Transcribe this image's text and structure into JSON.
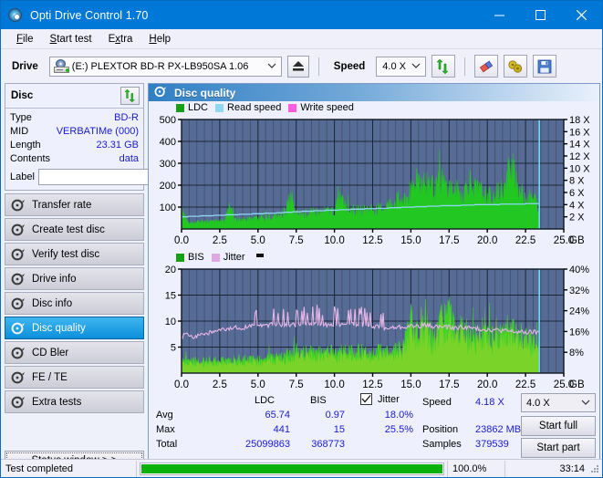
{
  "window": {
    "title": "Opti Drive Control 1.70",
    "icon": "disc-icon",
    "minimize_label": "–",
    "maximize_label": "□",
    "close_label": "✕",
    "accent": "#0078d7"
  },
  "menu": {
    "items": [
      {
        "label": "File",
        "accel": "F"
      },
      {
        "label": "Start test",
        "accel": "S"
      },
      {
        "label": "Extra",
        "accel": "x"
      },
      {
        "label": "Help",
        "accel": "H"
      }
    ]
  },
  "toolbar": {
    "drive_label": "Drive",
    "drive_value": "(E:)  PLEXTOR BD-R  PX-LB950SA 1.06",
    "eject_icon": "eject-icon",
    "speed_label": "Speed",
    "speed_value": "4.0 X",
    "refresh_icon": "refresh-icon",
    "eraser_icon": "eraser-icon",
    "bitsetting_icon": "bitsetting-icon",
    "save_icon": "save-icon"
  },
  "disc_panel": {
    "title": "Disc",
    "refresh_icon": "refresh-icon",
    "rows": [
      {
        "key": "Type",
        "value": "BD-R"
      },
      {
        "key": "MID",
        "value": "VERBATIMe (000)"
      },
      {
        "key": "Length",
        "value": "23.31 GB"
      },
      {
        "key": "Contents",
        "value": "data"
      }
    ],
    "label_key": "Label",
    "label_value": "",
    "label_placeholder": "",
    "label_button_icon": "disc-icon"
  },
  "sidebar": {
    "items": [
      {
        "label": "Transfer rate",
        "icon": "disc-test-icon",
        "active": false
      },
      {
        "label": "Create test disc",
        "icon": "disc-test-icon",
        "active": false
      },
      {
        "label": "Verify test disc",
        "icon": "disc-test-icon",
        "active": false
      },
      {
        "label": "Drive info",
        "icon": "disc-test-icon",
        "active": false
      },
      {
        "label": "Disc info",
        "icon": "disc-test-icon",
        "active": false
      },
      {
        "label": "Disc quality",
        "icon": "disc-test-icon",
        "active": true
      },
      {
        "label": "CD Bler",
        "icon": "disc-test-icon",
        "active": false
      },
      {
        "label": "FE / TE",
        "icon": "disc-test-icon",
        "active": false
      },
      {
        "label": "Extra tests",
        "icon": "disc-test-icon",
        "active": false
      }
    ],
    "status_window_label": "Status window > >"
  },
  "main": {
    "header_title": "Disc quality",
    "header_icon": "disc-quality-icon"
  },
  "chart_data": [
    {
      "type": "area",
      "id": "ldc-chart",
      "title": "",
      "legend": [
        {
          "label": "LDC",
          "color": "#16a016"
        },
        {
          "label": "Read speed",
          "color": "#8fd8f4"
        },
        {
          "label": "Write speed",
          "color": "#ff5ce0"
        }
      ],
      "legend_position": "top-left",
      "xlabel": "GB",
      "ylabel": "",
      "xlim": [
        0.0,
        25.0
      ],
      "xticks": [
        "0.0",
        "2.5",
        "5.0",
        "7.5",
        "10.0",
        "12.5",
        "15.0",
        "17.5",
        "20.0",
        "22.5",
        "25.0"
      ],
      "ylim": [
        0,
        500
      ],
      "yticks": [
        "100",
        "200",
        "300",
        "400",
        "500"
      ],
      "y2lim": [
        0,
        18
      ],
      "y2ticks": [
        "2 X",
        "4 X",
        "6 X",
        "8 X",
        "10 X",
        "12 X",
        "14 X",
        "16 X",
        "18 X"
      ],
      "grid": true,
      "plot_bg": "#566c96",
      "data_end_gb": 23.4,
      "marker_gb": 23.4,
      "series": [
        {
          "name": "LDC",
          "color": "#22c722",
          "x": [
            0.0,
            0.4,
            0.8,
            1.2,
            1.6,
            2.0,
            2.4,
            2.8,
            3.2,
            3.4,
            3.6,
            4.0,
            4.4,
            4.8,
            5.2,
            5.6,
            6.0,
            6.4,
            6.8,
            7.2,
            7.4,
            7.6,
            8.0,
            8.4,
            8.8,
            9.2,
            9.6,
            10.0,
            10.4,
            10.8,
            11.2,
            11.6,
            12.0,
            12.4,
            12.8,
            13.2,
            13.6,
            14.0,
            14.4,
            14.8,
            15.2,
            15.4,
            15.8,
            16.2,
            16.6,
            17.0,
            17.2,
            17.6,
            18.0,
            18.4,
            18.8,
            19.2,
            19.6,
            20.0,
            20.4,
            20.8,
            21.2,
            21.6,
            22.0,
            22.2,
            22.4,
            22.8,
            23.2,
            23.4
          ],
          "values": [
            120,
            42,
            40,
            45,
            48,
            44,
            50,
            48,
            170,
            60,
            55,
            58,
            60,
            62,
            68,
            70,
            75,
            80,
            110,
            200,
            95,
            90,
            95,
            100,
            105,
            100,
            110,
            115,
            200,
            120,
            118,
            115,
            120,
            125,
            118,
            135,
            150,
            175,
            180,
            200,
            270,
            340,
            280,
            300,
            230,
            310,
            260,
            250,
            230,
            200,
            310,
            240,
            225,
            200,
            215,
            230,
            255,
            440,
            290,
            220,
            200,
            190,
            175,
            60
          ]
        },
        {
          "name": "Read speed",
          "color": "#8fd8f4",
          "x": [
            0.0,
            1.0,
            2.0,
            3.0,
            4.0,
            5.0,
            6.0,
            7.0,
            8.0,
            9.0,
            10.0,
            11.0,
            12.0,
            13.0,
            14.0,
            15.0,
            16.0,
            17.0,
            18.0,
            19.0,
            20.0,
            21.0,
            22.0,
            23.0,
            23.4
          ],
          "values": [
            2.0,
            2.1,
            2.2,
            2.3,
            2.4,
            2.5,
            2.6,
            2.75,
            2.9,
            3.0,
            3.1,
            3.2,
            3.3,
            3.4,
            3.5,
            3.6,
            3.7,
            3.8,
            3.85,
            3.95,
            4.0,
            4.05,
            4.1,
            4.15,
            4.18
          ]
        }
      ]
    },
    {
      "type": "area",
      "id": "bis-jitter-chart",
      "title": "",
      "legend": [
        {
          "label": "BIS",
          "color": "#16a016"
        },
        {
          "label": "Jitter",
          "color": "#e0a8e0"
        }
      ],
      "legend_position": "top-left",
      "xlabel": "GB",
      "ylabel": "",
      "xlim": [
        0.0,
        25.0
      ],
      "xticks": [
        "0.0",
        "2.5",
        "5.0",
        "7.5",
        "10.0",
        "12.5",
        "15.0",
        "17.5",
        "20.0",
        "22.5",
        "25.0"
      ],
      "ylim": [
        0,
        20
      ],
      "yticks": [
        "5",
        "10",
        "15",
        "20"
      ],
      "y2lim": [
        0,
        40
      ],
      "y2ticks": [
        "8%",
        "16%",
        "24%",
        "32%",
        "40%"
      ],
      "grid": true,
      "plot_bg": "#566c96",
      "data_end_gb": 23.4,
      "marker_gb": 23.4,
      "series": [
        {
          "name": "BIS",
          "color": "#33d433",
          "x": [
            0.0,
            0.5,
            1.0,
            1.5,
            2.0,
            2.5,
            3.0,
            3.5,
            4.0,
            4.5,
            5.0,
            5.5,
            6.0,
            6.5,
            7.0,
            7.5,
            8.0,
            8.5,
            9.0,
            9.5,
            10.0,
            10.5,
            11.0,
            11.5,
            12.0,
            12.5,
            13.0,
            13.5,
            14.0,
            14.5,
            15.0,
            15.2,
            15.6,
            16.0,
            16.5,
            17.0,
            17.5,
            17.9,
            18.3,
            18.8,
            19.3,
            19.8,
            20.3,
            20.8,
            21.3,
            21.8,
            22.2,
            22.6,
            23.0,
            23.4
          ],
          "values": [
            3.0,
            3.2,
            3.1,
            3.0,
            3.3,
            3.2,
            3.1,
            3.3,
            3.2,
            3.4,
            3.6,
            3.5,
            3.8,
            4.2,
            4.6,
            5.0,
            5.2,
            5.4,
            5.3,
            5.5,
            5.6,
            5.4,
            5.5,
            5.7,
            5.6,
            5.8,
            5.5,
            5.7,
            6.0,
            6.4,
            13.0,
            9.0,
            10.5,
            12.0,
            8.5,
            13.0,
            15.0,
            9.5,
            13.0,
            8.6,
            9.0,
            11.0,
            8.8,
            9.2,
            12.2,
            10.0,
            8.6,
            9.0,
            7.5,
            6.0
          ]
        },
        {
          "name": "Jitter",
          "color": "#e7b6e7",
          "x": [
            0.0,
            0.3,
            0.6,
            0.9,
            1.2,
            1.5,
            1.8,
            2.1,
            2.4,
            2.7,
            3.0,
            3.3,
            3.6,
            3.9,
            4.2,
            4.5,
            4.8,
            5.1,
            5.4,
            5.7,
            6.0,
            6.5,
            7.0,
            7.5,
            8.0,
            8.5,
            9.0,
            9.5,
            10.0,
            10.5,
            11.0,
            11.5,
            12.0,
            12.5,
            13.0,
            13.5,
            14.0,
            14.5,
            15.0,
            15.5,
            16.0,
            16.5,
            17.0,
            17.5,
            18.0,
            18.5,
            19.0,
            19.5,
            20.0,
            20.5,
            21.0,
            21.5,
            22.0,
            22.5,
            23.0,
            23.4
          ],
          "values": [
            7.0,
            7.4,
            7.2,
            7.0,
            7.6,
            7.5,
            7.8,
            7.9,
            8.1,
            8.3,
            8.4,
            8.6,
            8.8,
            8.7,
            8.9,
            9.0,
            9.2,
            9.1,
            9.3,
            9.2,
            9.3,
            9.1,
            9.4,
            9.2,
            9.4,
            9.5,
            9.4,
            9.3,
            9.5,
            9.4,
            9.5,
            9.3,
            9.4,
            9.1,
            8.7,
            8.6,
            8.8,
            8.9,
            9.0,
            9.1,
            9.2,
            9.0,
            8.9,
            8.8,
            8.7,
            8.9,
            8.6,
            8.5,
            8.4,
            8.3,
            8.2,
            8.0,
            7.9,
            7.8,
            7.9,
            7.8
          ]
        }
      ]
    }
  ],
  "stats": {
    "col_headers": [
      "LDC",
      "BIS"
    ],
    "row_headers": [
      "Avg",
      "Max",
      "Total"
    ],
    "ldc": {
      "avg": "65.74",
      "max": "441",
      "total": "25099863"
    },
    "bis": {
      "avg": "0.97",
      "max": "15",
      "total": "368773"
    },
    "jitter": {
      "label": "Jitter",
      "checked": true,
      "avg": "18.0%",
      "max": "25.5%"
    },
    "speed_label": "Speed",
    "speed_value": "4.18 X",
    "position_label": "Position",
    "position_value": "23862 MB",
    "samples_label": "Samples",
    "samples_value": "379539",
    "speed_select": "4.0 X",
    "start_full_label": "Start full",
    "start_part_label": "Start part"
  },
  "statusbar": {
    "message": "Test completed",
    "progress_percent": "100.0%",
    "progress_value": 100,
    "elapsed": "33:14"
  }
}
